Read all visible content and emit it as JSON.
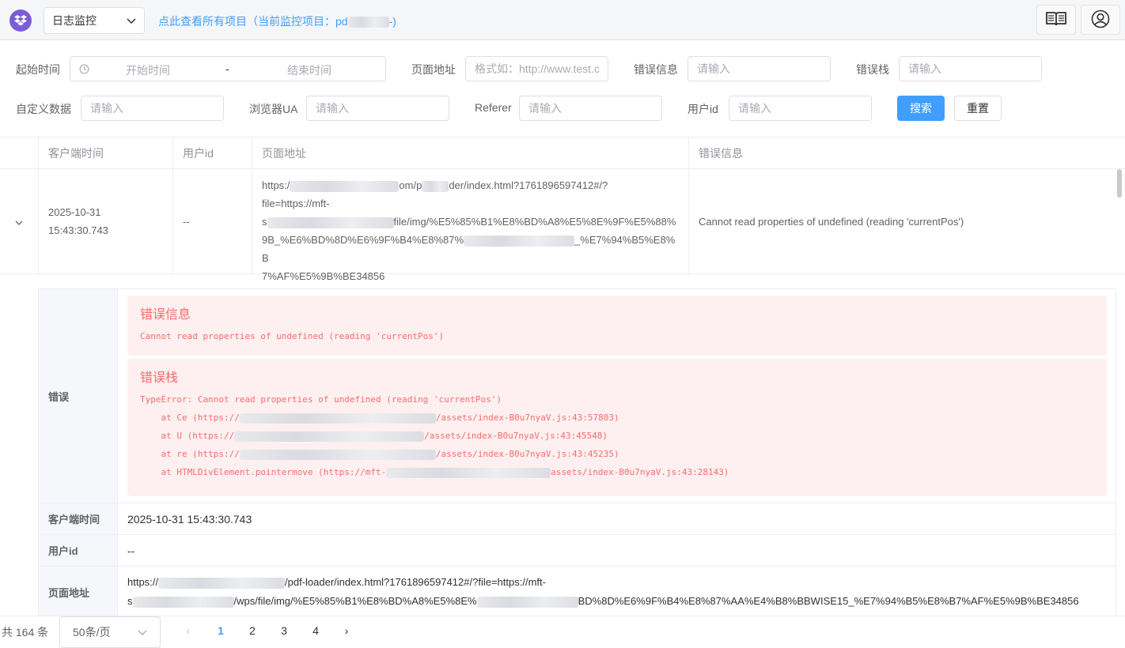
{
  "header": {
    "app_select": "日志监控",
    "project_link_prefix": "点此查看所有项目（当前监控项目：pd",
    "project_link_suffix": "-)",
    "icons": {
      "logo": "dropbox-logo-icon",
      "docs": "book-icon",
      "user": "user-circle-icon"
    }
  },
  "filters": {
    "time_label": "起始时间",
    "start_placeholder": "开始时间",
    "range_sep": "-",
    "end_placeholder": "结束时间",
    "page_url_label": "页面地址",
    "page_url_placeholder": "格式如：http://www.test.c",
    "error_info_label": "错误信息",
    "error_info_placeholder": "请输入",
    "error_stack_label": "错误栈",
    "error_stack_placeholder": "请输入",
    "custom_label": "自定义数据",
    "custom_placeholder": "请输入",
    "ua_label": "浏览器UA",
    "ua_placeholder": "请输入",
    "referer_label": "Referer",
    "referer_placeholder": "请输入",
    "userid_label": "用户id",
    "userid_placeholder": "请输入",
    "search_btn": "搜索",
    "reset_btn": "重置"
  },
  "table": {
    "columns": [
      "客户端时间",
      "用户id",
      "页面地址",
      "错误信息"
    ],
    "row": {
      "time_line1": "2025-10-31",
      "time_line2": "15:43:30.743",
      "user_id": "--",
      "url_l1_a": "https:/",
      "url_l1_b": "om/p",
      "url_l1_c": "der/index.html?1761896597412#/?",
      "url_l2": "file=https://mft-",
      "url_l3_a": "s",
      "url_l3_b": "file/img/%E5%85%B1%E8%BD%A8%E5%8E%9F%E5%88%",
      "url_l4_a": "9B_%E6%BD%8D%E6%9F%B4%E8%87%",
      "url_l4_b": "_%E7%94%B5%E8%B",
      "url_l5": "7%AF%E5%9B%BE34856",
      "error": "Cannot read properties of undefined (reading 'currentPos')"
    }
  },
  "detail": {
    "error_label": "错误",
    "err_info_title": "错误信息",
    "err_info_text": "Cannot read properties of undefined (reading 'currentPos')",
    "err_stack_title": "错误栈",
    "stack": [
      {
        "a": "TypeError: Cannot read properties of undefined (reading 'currentPos')",
        "b": ""
      },
      {
        "a": "    at Ce (https://",
        "b": "/assets/index-B0u7nyaV.js:43:57803)"
      },
      {
        "a": "    at U (https://",
        "b": "/assets/index-B0u7nyaV.js:43:45548)"
      },
      {
        "a": "    at re (https://",
        "b": "/assets/index-B0u7nyaV.js:43:45235)"
      },
      {
        "a": "    at HTMLDivElement.pointermove (https://mft-",
        "b": "assets/index-B0u7nyaV.js:43:28143)"
      }
    ],
    "client_time_label": "客户端时间",
    "client_time_value": "2025-10-31 15:43:30.743",
    "user_id_label": "用户id",
    "user_id_value": "--",
    "page_url_label": "页面地址",
    "page_url_l1_a": "https://",
    "page_url_l1_b": "/pdf-loader/index.html?1761896597412#/?file=https://mft-",
    "page_url_l2_a": "s",
    "page_url_l2_b": "/wps/file/img/%E5%85%B1%E8%BD%A8%E5%8E%",
    "page_url_l2_c": "BD%8D%E6%9F%B4%E8%87%AA%E4%B8%BBWISE15_%E7%94%B5%E8%B7%AF%E5%9B%BE34856"
  },
  "pagination": {
    "total": "共 164 条",
    "page_size": "50条/页",
    "pages": [
      "1",
      "2",
      "3",
      "4"
    ],
    "current": "1",
    "prev": "‹",
    "next": "›"
  }
}
